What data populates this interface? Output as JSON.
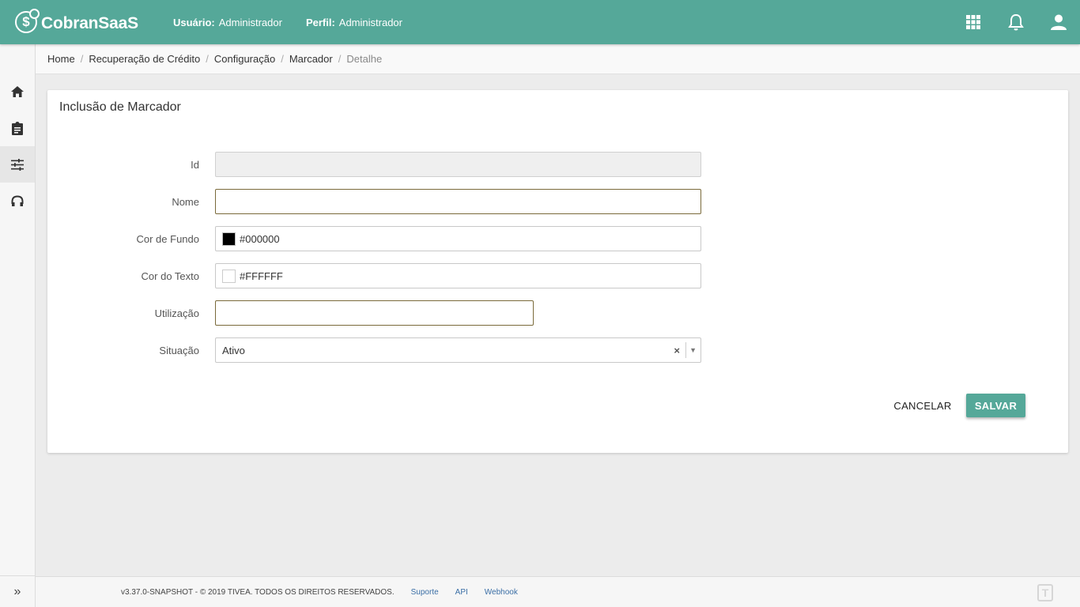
{
  "app": {
    "name": "CobranSaaS"
  },
  "header": {
    "user_label": "Usuário:",
    "user_value": "Administrador",
    "profile_label": "Perfil:",
    "profile_value": "Administrador",
    "icons": [
      "apps-grid-icon",
      "bell-icon",
      "user-icon"
    ]
  },
  "sidebar": {
    "items": [
      {
        "icon": "home-icon",
        "active": false
      },
      {
        "icon": "clipboard-icon",
        "active": false
      },
      {
        "icon": "sliders-icon",
        "active": true
      },
      {
        "icon": "headset-icon",
        "active": false
      }
    ],
    "toggle": "»"
  },
  "breadcrumb": {
    "items": [
      "Home",
      "Recuperação de Crédito",
      "Configuração",
      "Marcador",
      "Detalhe"
    ]
  },
  "form": {
    "title": "Inclusão de Marcador",
    "fields": {
      "id": {
        "label": "Id",
        "value": ""
      },
      "nome": {
        "label": "Nome",
        "value": ""
      },
      "cor_fundo": {
        "label": "Cor de Fundo",
        "value": "#000000",
        "swatch": "#000000"
      },
      "cor_texto": {
        "label": "Cor do Texto",
        "value": "#FFFFFF",
        "swatch": "#FFFFFF"
      },
      "utilizacao": {
        "label": "Utilização",
        "value": ""
      },
      "situacao": {
        "label": "Situação",
        "value": "Ativo",
        "clear": "×",
        "arrow": "▼"
      }
    },
    "cancel_label": "CANCELAR",
    "save_label": "SALVAR"
  },
  "footer": {
    "copyright": "v3.37.0-SNAPSHOT - © 2019 TIVEA. TODOS OS DIREITOS RESERVADOS.",
    "links": [
      "Suporte",
      "API",
      "Webhook"
    ],
    "logo_text": "T"
  },
  "colors": {
    "primary": "#55a899",
    "focus_border": "#7a6a3a",
    "link": "#3a6ea5"
  }
}
